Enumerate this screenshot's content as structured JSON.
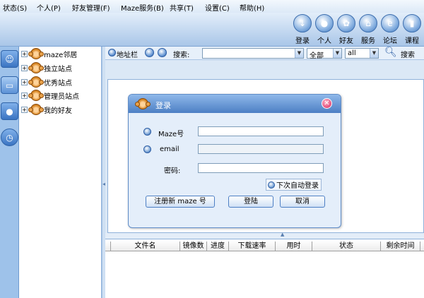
{
  "menu": [
    "状态(S)",
    "个人(P)",
    "好友管理(F)",
    "Maze服务(B)",
    "共享(T)",
    "设置(C)",
    "帮助(H)"
  ],
  "toolbar": [
    {
      "label": "登录",
      "icon": "login-icon"
    },
    {
      "label": "个人",
      "icon": "person-icon"
    },
    {
      "label": "好友",
      "icon": "friends-icon"
    },
    {
      "label": "服务",
      "icon": "service-icon"
    },
    {
      "label": "论坛",
      "icon": "forum-icon"
    },
    {
      "label": "课程",
      "icon": "course-icon"
    }
  ],
  "tree": [
    "maze邻居",
    "独立站点",
    "优秀站点",
    "管理员站点",
    "我的好友"
  ],
  "addressbar": {
    "label": "地址栏",
    "search_label": "搜索:",
    "scope": "全部",
    "filter": "all",
    "search_button": "搜索"
  },
  "grid_headers": [
    "文件名",
    "镜像数",
    "进度",
    "下载速率",
    "用时",
    "状态",
    "剩余时间"
  ],
  "dialog": {
    "title": "登录",
    "maze_label": "Maze号",
    "email_label": "email",
    "password_label": "密码:",
    "auto_login": "下次自动登录",
    "register": "注册新 maze 号",
    "login": "登陆",
    "cancel": "取消"
  }
}
